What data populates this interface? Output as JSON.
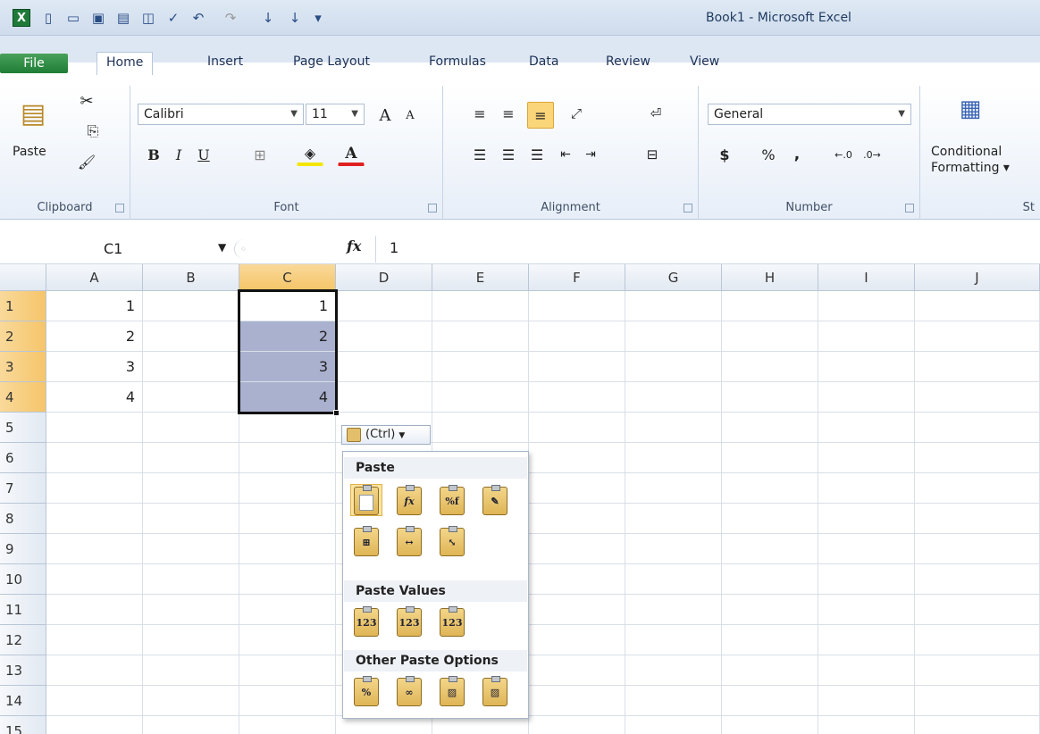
{
  "window": {
    "title": "Book1 - Microsoft Excel"
  },
  "tabs": [
    "File",
    "Home",
    "Insert",
    "Page Layout",
    "Formulas",
    "Data",
    "Review",
    "View"
  ],
  "ribbon": {
    "clipboard": {
      "paste": "Paste",
      "label": "Clipboard"
    },
    "font": {
      "name": "Calibri",
      "size": "11",
      "label": "Font",
      "bold": "B",
      "italic": "I",
      "underline": "U",
      "grow": "A",
      "shrink": "A",
      "color": "A"
    },
    "alignment": {
      "label": "Alignment"
    },
    "number": {
      "format": "General",
      "currency": "$",
      "percent": "%",
      "comma": ",",
      "label": "Number"
    },
    "styles": {
      "conditional_line1": "Conditional",
      "conditional_line2": "Formatting",
      "label": "St"
    }
  },
  "formula_bar": {
    "name_box": "C1",
    "fx": "fx",
    "value": "1"
  },
  "columns": [
    "A",
    "B",
    "C",
    "D",
    "E",
    "F",
    "G",
    "H",
    "I",
    "J"
  ],
  "rows": [
    "1",
    "2",
    "3",
    "4",
    "5",
    "6",
    "7",
    "8",
    "9",
    "10",
    "11",
    "12",
    "13",
    "14",
    "15"
  ],
  "cells": {
    "A1": "1",
    "A2": "2",
    "A3": "3",
    "A4": "4",
    "C1": "1",
    "C2": "2",
    "C3": "3",
    "C4": "4"
  },
  "paste_options": {
    "ctrl_label": "(Ctrl)",
    "paste_header": "Paste",
    "values_header": "Paste Values",
    "other_header": "Other Paste Options",
    "values_icons": [
      "123",
      "123",
      "123"
    ]
  },
  "colors": {
    "selection": "#a9b1cf",
    "header_selected": "#f5c56a",
    "file_tab": "#1e7d36"
  }
}
